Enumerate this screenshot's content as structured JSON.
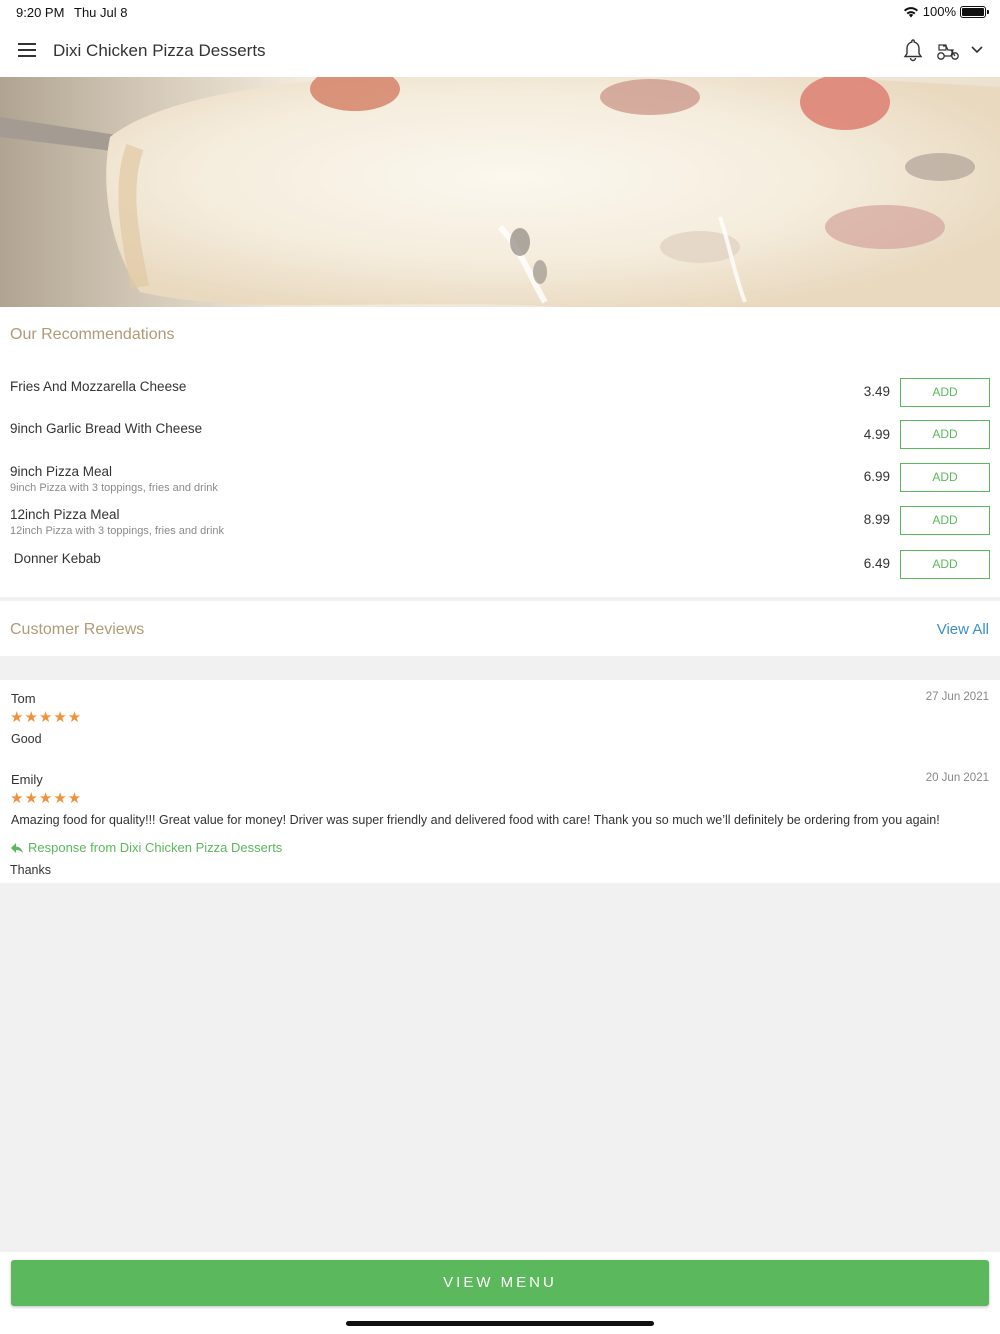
{
  "status_bar": {
    "time": "9:20 PM",
    "date": "Thu Jul 8",
    "battery": "100%"
  },
  "app_bar": {
    "title": "Dixi Chicken Pizza Desserts",
    "icons": [
      "menu-icon",
      "bell-icon",
      "scooter-icon",
      "chevron-down-icon"
    ]
  },
  "recommendations": {
    "title": "Our Recommendations",
    "add_label": "ADD",
    "items": [
      {
        "name": "Fries And Mozzarella Cheese",
        "desc": "",
        "price": "3.49"
      },
      {
        "name": "9inch Garlic Bread With Cheese",
        "desc": "",
        "price": "4.99"
      },
      {
        "name": "9inch Pizza Meal",
        "desc": "9inch Pizza with 3 toppings, fries and drink",
        "price": "6.99"
      },
      {
        "name": "12inch Pizza Meal",
        "desc": "12inch Pizza with 3 toppings, fries and drink",
        "price": "8.99"
      },
      {
        "name": " Donner Kebab",
        "desc": "",
        "price": "6.49"
      }
    ]
  },
  "reviews": {
    "title": "Customer Reviews",
    "view_all": "View All",
    "items": [
      {
        "name": "Tom",
        "date": "27 Jun 2021",
        "stars": "★★★★★",
        "rating": 5,
        "text": "Good"
      },
      {
        "name": "Emily",
        "date": "20 Jun 2021",
        "stars": "★★★★★",
        "rating": 5,
        "text": "Amazing food for quality!!! Great value for money! Driver was super friendly and delivered food with care! Thank you so much we’ll definitely be ordering from you again!",
        "response_label": "Response from Dixi Chicken Pizza Desserts",
        "response_text": "Thanks"
      }
    ]
  },
  "view_menu": "VIEW MENU",
  "colors": {
    "accent_green": "#5cb85c",
    "section_title": "#b19a78",
    "link_blue": "#3a8fc9",
    "star": "#f0923b"
  }
}
